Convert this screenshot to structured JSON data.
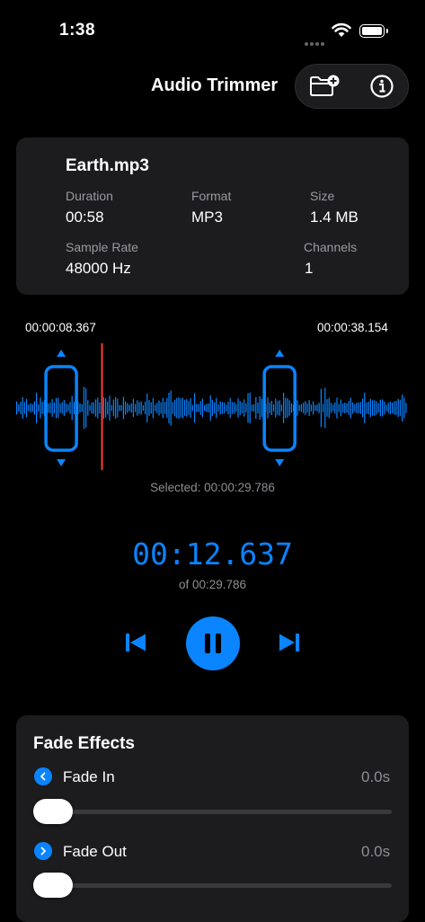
{
  "status": {
    "time": "1:38"
  },
  "nav": {
    "title": "Audio Trimmer"
  },
  "file": {
    "name": "Earth.mp3",
    "duration_label": "Duration",
    "duration": "00:58",
    "format_label": "Format",
    "format": "MP3",
    "size_label": "Size",
    "size": "1.4 MB",
    "sample_rate_label": "Sample Rate",
    "sample_rate": "48000 Hz",
    "channels_label": "Channels",
    "channels": "1"
  },
  "trim": {
    "start": "00:00:08.367",
    "end": "00:00:38.154",
    "selected": "Selected: 00:00:29.786",
    "start_fraction": 0.144,
    "end_fraction": 0.658,
    "playhead_fraction": 0.24
  },
  "playback": {
    "current": "00:12.637",
    "total": "of 00:29.786",
    "state": "playing"
  },
  "fade": {
    "title": "Fade Effects",
    "in_label": "Fade In",
    "in_value": "0.0s",
    "in_fraction": 0,
    "out_label": "Fade Out",
    "out_value": "0.0s",
    "out_fraction": 0
  },
  "colors": {
    "accent": "#0a84ff",
    "playhead": "#ff3b30",
    "card": "#1c1c1e",
    "background": "#000000"
  }
}
